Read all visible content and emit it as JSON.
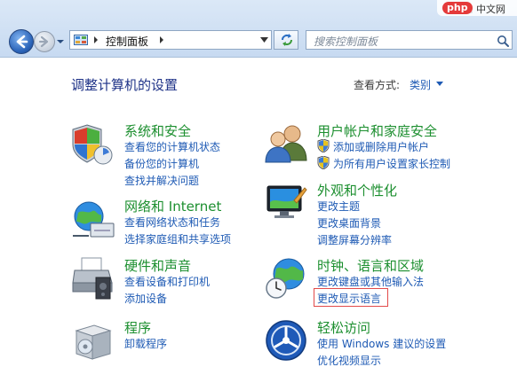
{
  "watermark": {
    "brand": "php",
    "text": "中文网"
  },
  "address": {
    "path": "控制面板"
  },
  "search": {
    "placeholder": "搜索控制面板"
  },
  "header": {
    "title": "调整计算机的设置",
    "view_label": "查看方式:",
    "view_value": "类别"
  },
  "categories": {
    "system": {
      "title": "系统和安全",
      "links": [
        "查看您的计算机状态",
        "备份您的计算机",
        "查找并解决问题"
      ]
    },
    "network": {
      "title": "网络和 Internet",
      "links": [
        "查看网络状态和任务",
        "选择家庭组和共享选项"
      ]
    },
    "hardware": {
      "title": "硬件和声音",
      "links": [
        "查看设备和打印机",
        "添加设备"
      ]
    },
    "programs": {
      "title": "程序",
      "links": [
        "卸载程序"
      ]
    },
    "users": {
      "title": "用户帐户和家庭安全",
      "links": [
        "添加或删除用户帐户",
        "为所有用户设置家长控制"
      ]
    },
    "appearance": {
      "title": "外观和个性化",
      "links": [
        "更改主题",
        "更改桌面背景",
        "调整屏幕分辨率"
      ]
    },
    "clock": {
      "title": "时钟、语言和区域",
      "links": [
        "更改键盘或其他输入法",
        "更改显示语言"
      ]
    },
    "ease": {
      "title": "轻松访问",
      "links": [
        "使用 Windows 建议的设置",
        "优化视频显示"
      ]
    }
  },
  "colors": {
    "heading": "#1c8f2f",
    "link": "#1e5ab4",
    "title": "#1e3287",
    "highlight": "#e24a4a"
  }
}
